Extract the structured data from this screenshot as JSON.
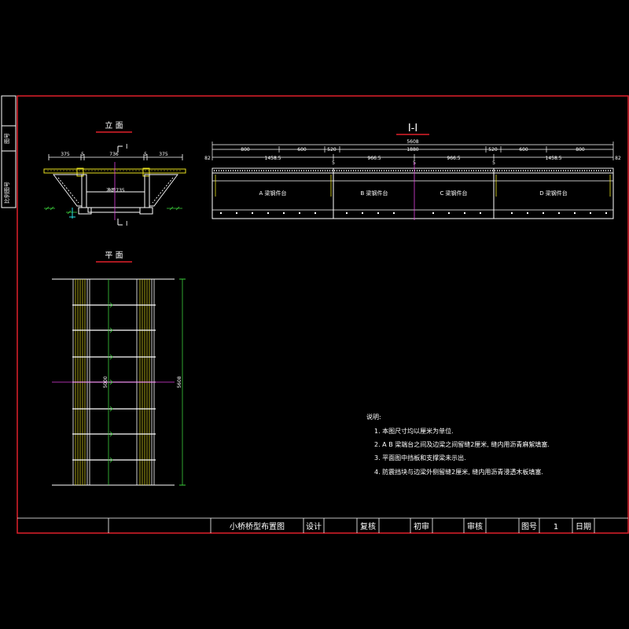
{
  "side_labels": {
    "top": "图号",
    "bottom": "比例图号"
  },
  "elevation": {
    "title": "立 面",
    "section_mark": "I",
    "dims": [
      "375",
      "5",
      "736",
      "5",
      "375"
    ],
    "span_label": "净跨735"
  },
  "plan": {
    "title": "平 面",
    "length_label": "5608",
    "inner_label": "5000"
  },
  "section": {
    "title": "I-I",
    "dims_top": [
      "800",
      "600",
      "520",
      "1880",
      "520",
      "600",
      "800"
    ],
    "total": "5608",
    "dims_bottom": [
      "82",
      "1458.5",
      "5",
      "966.5",
      "5",
      "966.5",
      "5",
      "1458.5",
      "82"
    ],
    "beams": [
      "A 梁钢件台",
      "B 梁钢件台",
      "C 梁钢件台",
      "D 梁钢件台"
    ]
  },
  "notes": {
    "heading": "说明:",
    "items": [
      "1. 本图尺寸均以厘米为单位.",
      "2. A B 梁端台之间及边梁之间留缝2厘米, 缝内用沥青麻絮填塞.",
      "3. 平面图中挡板和支撑梁未示出.",
      "4. 防震挡块与边梁外侧留缝2厘米, 缝内用沥青浸透木板填塞."
    ]
  },
  "title_block": {
    "drawing_name": "小桥桥型布置图",
    "design": "设计",
    "review": "复核",
    "check": "初审",
    "audit": "审核",
    "sheet_label": "图号",
    "sheet_no": "1",
    "date": "日期"
  },
  "colors": {
    "frame": "#e0202a",
    "line": "#ffffff",
    "cyan": "#28e0e0",
    "green": "#3ccf3c",
    "magenta": "#e040e0",
    "yellow": "#e8e020"
  }
}
